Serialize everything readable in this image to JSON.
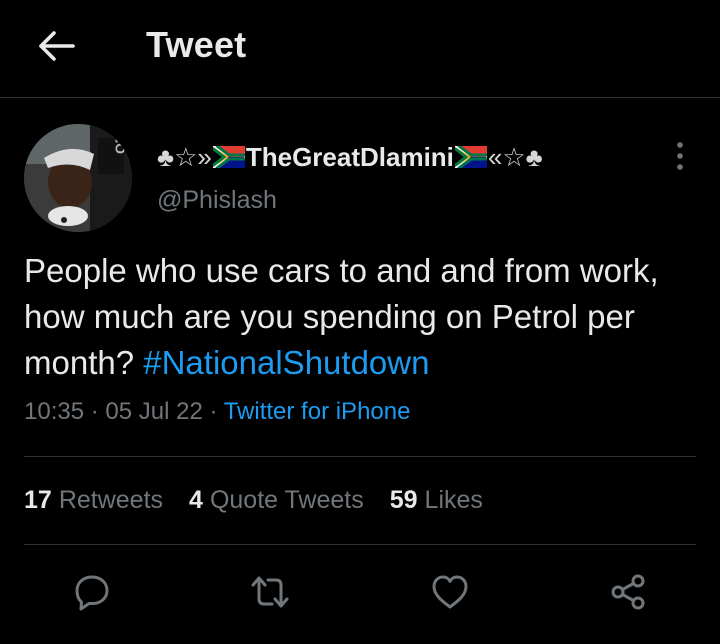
{
  "header": {
    "title": "Tweet",
    "back_icon": "arrow-left-icon"
  },
  "tweet": {
    "author": {
      "name_prefix": "♣☆»",
      "name": "TheGreatDlamini",
      "name_suffix": "«☆♣",
      "handle": "@Phislash"
    },
    "text_parts": [
      "People who use cars to and and from work, how much are you spending on Petrol per month? ",
      "#NationalShutdown"
    ],
    "time": "10:35",
    "date": "05 Jul 22",
    "source": "Twitter for iPhone",
    "separator": " · "
  },
  "stats": {
    "retweets_count": "17",
    "retweets_label": "Retweets",
    "quotes_count": "4",
    "quotes_label": "Quote Tweets",
    "likes_count": "59",
    "likes_label": "Likes"
  },
  "colors": {
    "background": "#000000",
    "text": "#e7e9ea",
    "secondary": "#71767b",
    "accent": "#1d9bf0",
    "divider": "#2f3336"
  },
  "icons": {
    "more": "more-vertical-icon",
    "reply": "reply-icon",
    "retweet": "retweet-icon",
    "like": "heart-icon",
    "share": "share-icon",
    "flag": "south-africa-flag-icon"
  }
}
